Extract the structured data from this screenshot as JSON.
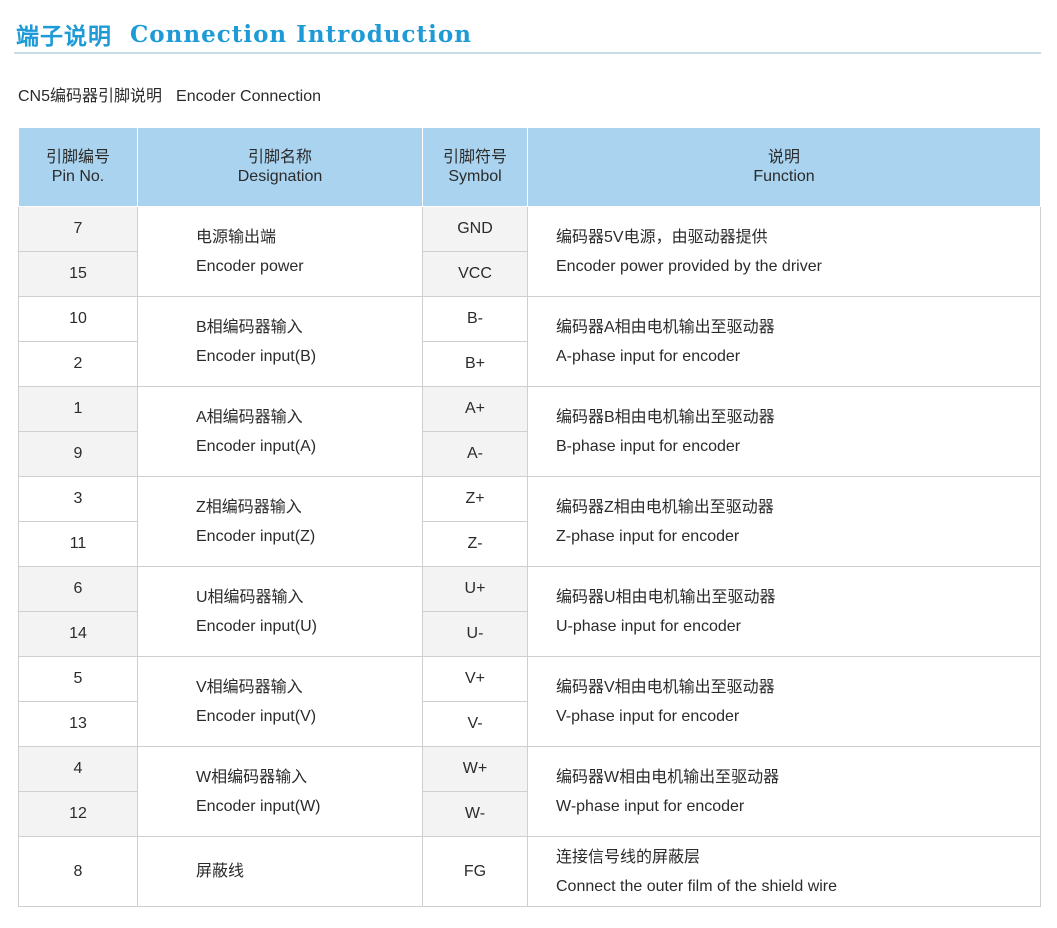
{
  "header": {
    "title_cn": "端子说明",
    "title_en": "Connection Introduction"
  },
  "section": {
    "label_cn": "CN5编码器引脚说明",
    "label_en": "Encoder Connection"
  },
  "table": {
    "columns": [
      {
        "cn": "引脚编号",
        "en": "Pin No."
      },
      {
        "cn": "引脚名称",
        "en": "Designation"
      },
      {
        "cn": "引脚符号",
        "en": "Symbol"
      },
      {
        "cn": "说明",
        "en": "Function"
      }
    ],
    "groups": [
      {
        "pins": [
          "7",
          "15"
        ],
        "symbols": [
          "GND",
          "VCC"
        ],
        "designation_cn": "电源输出端",
        "designation_en": "Encoder power",
        "function_cn": "编码器5V电源，由驱动器提供",
        "function_en": "Encoder power provided by the driver"
      },
      {
        "pins": [
          "10",
          "2"
        ],
        "symbols": [
          "B-",
          "B+"
        ],
        "designation_cn": "B相编码器输入",
        "designation_en": "Encoder input(B)",
        "function_cn": "编码器A相由电机输出至驱动器",
        "function_en": "A-phase input for encoder"
      },
      {
        "pins": [
          "1",
          "9"
        ],
        "symbols": [
          "A+",
          "A-"
        ],
        "designation_cn": "A相编码器输入",
        "designation_en": "Encoder input(A)",
        "function_cn": "编码器B相由电机输出至驱动器",
        "function_en": "B-phase input for encoder"
      },
      {
        "pins": [
          "3",
          "11"
        ],
        "symbols": [
          "Z+",
          "Z-"
        ],
        "designation_cn": "Z相编码器输入",
        "designation_en": "Encoder input(Z)",
        "function_cn": "编码器Z相由电机输出至驱动器",
        "function_en": "Z-phase input for encoder"
      },
      {
        "pins": [
          "6",
          "14"
        ],
        "symbols": [
          "U+",
          "U-"
        ],
        "designation_cn": "U相编码器输入",
        "designation_en": "Encoder input(U)",
        "function_cn": "编码器U相由电机输出至驱动器",
        "function_en": "U-phase input for encoder"
      },
      {
        "pins": [
          "5",
          "13"
        ],
        "symbols": [
          "V+",
          "V-"
        ],
        "designation_cn": "V相编码器输入",
        "designation_en": "Encoder input(V)",
        "function_cn": "编码器V相由电机输出至驱动器",
        "function_en": "V-phase input for encoder"
      },
      {
        "pins": [
          "4",
          "12"
        ],
        "symbols": [
          "W+",
          "W-"
        ],
        "designation_cn": "W相编码器输入",
        "designation_en": "Encoder input(W)",
        "function_cn": "编码器W相由电机输出至驱动器",
        "function_en": "W-phase input for encoder"
      }
    ],
    "single": {
      "pin": "8",
      "symbol": "FG",
      "designation_cn": "屏蔽线",
      "function_cn": "连接信号线的屏蔽层",
      "function_en": "Connect the outer film of the shield wire"
    }
  },
  "colors": {
    "title": "#1e9bd7",
    "header_bg": "#a9d3ef",
    "shaded_row": "#f3f3f3",
    "rule": "#c9dbe6"
  }
}
